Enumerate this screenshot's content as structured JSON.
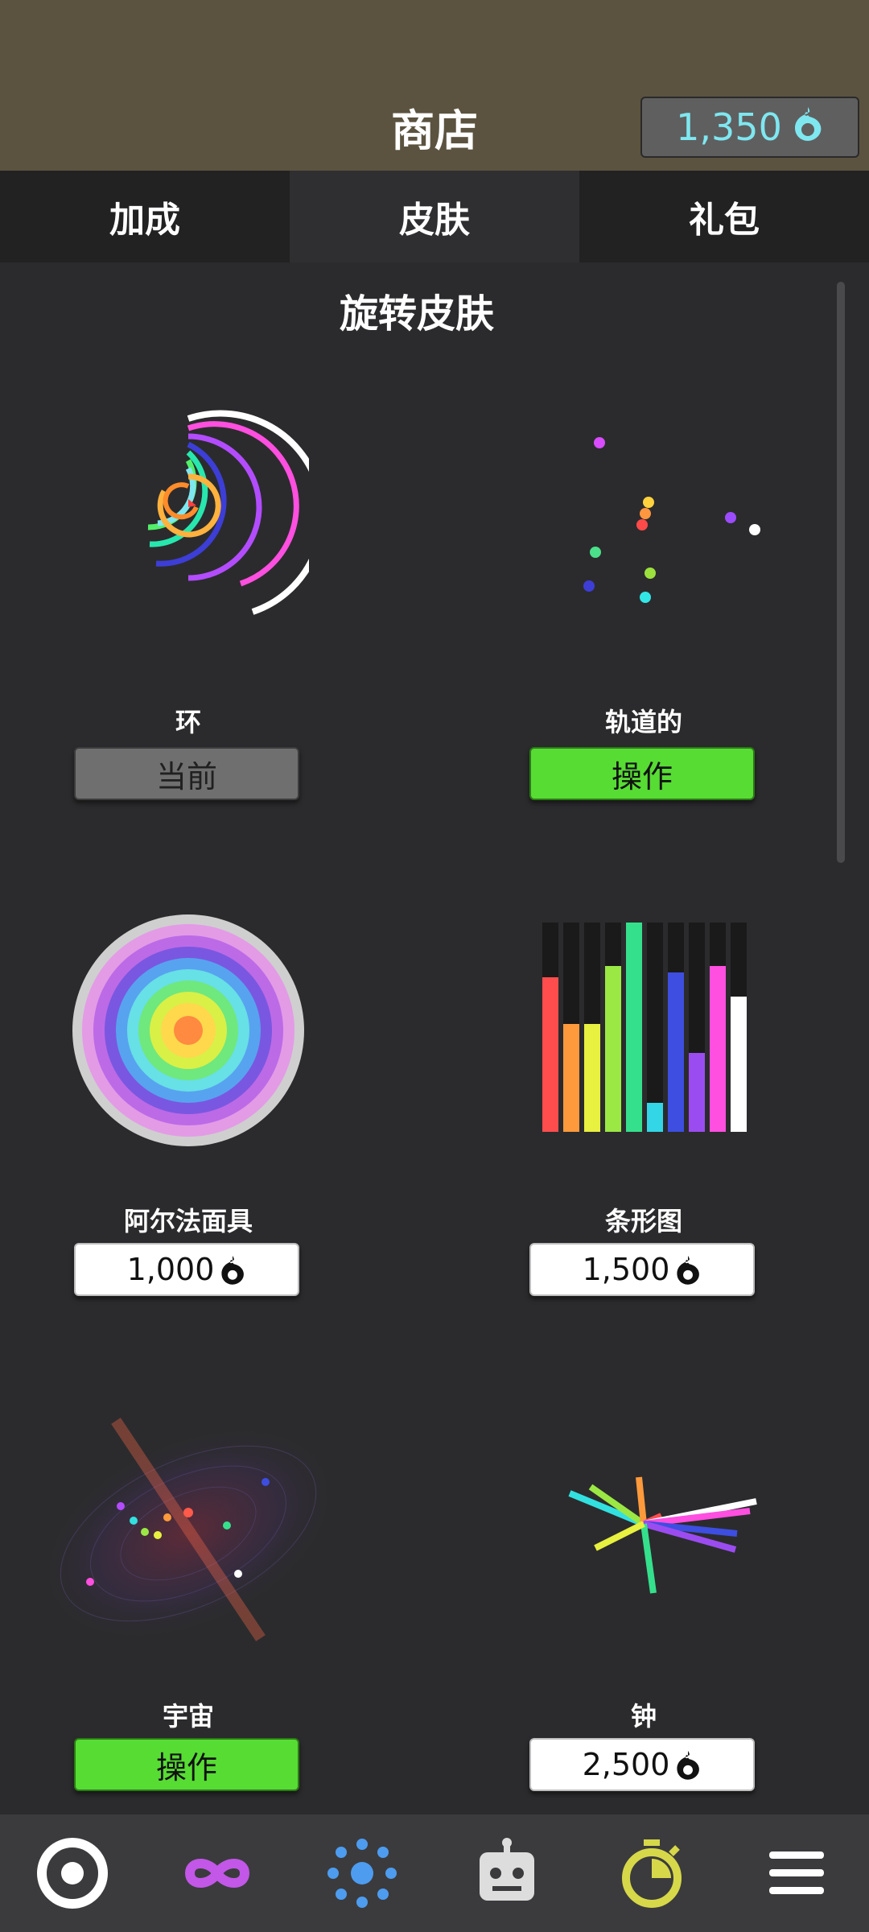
{
  "header": {
    "title": "商店",
    "coins": "1,350"
  },
  "tabs": [
    {
      "label": "加成",
      "active": false
    },
    {
      "label": "皮肤",
      "active": true
    },
    {
      "label": "礼包",
      "active": false
    }
  ],
  "section_title": "旋转皮肤",
  "items": [
    {
      "name": "环",
      "button": "当前"
    },
    {
      "name": "轨道的",
      "button": "操作"
    },
    {
      "name": "阿尔法面具",
      "button": "1,000"
    },
    {
      "name": "条形图",
      "button": "1,500"
    },
    {
      "name": "宇宙",
      "button": "操作"
    },
    {
      "name": "钟",
      "button": "2,500"
    }
  ],
  "nav": [
    {
      "icon": "target-icon"
    },
    {
      "icon": "infinity-icon"
    },
    {
      "icon": "dots-circle-icon"
    },
    {
      "icon": "robot-icon"
    },
    {
      "icon": "stopwatch-icon"
    },
    {
      "icon": "menu-icon"
    }
  ],
  "colors": {
    "accent_green": "#57dc34",
    "coin_cyan": "#7fe7f0",
    "header_brown": "#5b5340"
  }
}
